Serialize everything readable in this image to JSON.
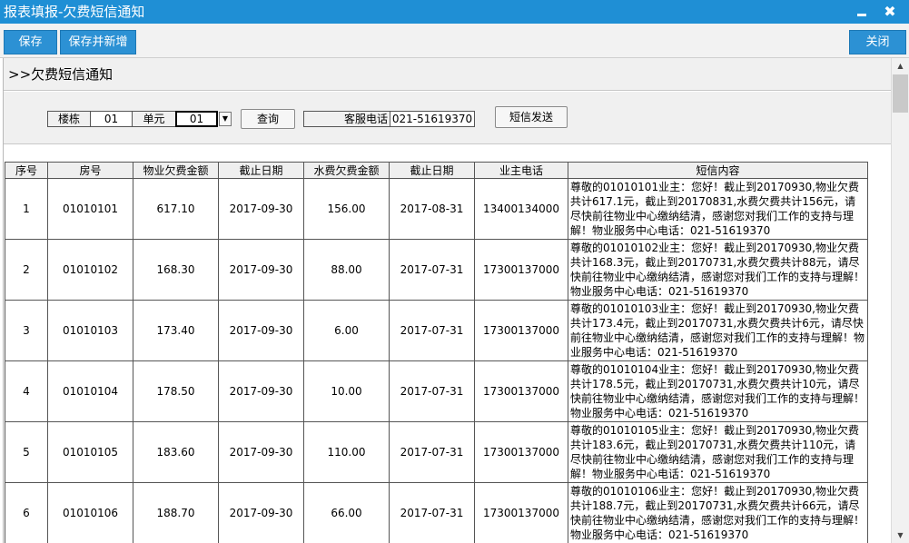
{
  "window": {
    "title": "报表填报-欠费短信通知",
    "minimize_icon": "minimize-icon",
    "close_icon": "close-icon",
    "close_glyph": "✖"
  },
  "toolbar": {
    "save_label": "保存",
    "save_new_label": "保存并新增",
    "close_label": "关闭"
  },
  "section": {
    "title": ">>欠费短信通知"
  },
  "filter": {
    "building_label": "楼栋",
    "building_value": "01",
    "unit_label": "单元",
    "unit_value": "01",
    "dropdown_glyph": "▼",
    "query_label": "查询",
    "service_phone_label": "客服电话",
    "service_phone_value": "021-51619370",
    "sms_send_label": "短信发送"
  },
  "table": {
    "headers": [
      "序号",
      "房号",
      "物业欠费金额",
      "截止日期",
      "水费欠费金额",
      "截止日期",
      "业主电话",
      "短信内容"
    ],
    "rows": [
      [
        "1",
        "01010101",
        "617.10",
        "2017-09-30",
        "156.00",
        "2017-08-31",
        "13400134000",
        "尊敬的01010101业主：您好！截止到20170930,物业欠费共计617.1元，截止到20170831,水费欠费共计156元，请尽快前往物业中心缴纳结清，感谢您对我们工作的支持与理解！物业服务中心电话：021-51619370"
      ],
      [
        "2",
        "01010102",
        "168.30",
        "2017-09-30",
        "88.00",
        "2017-07-31",
        "17300137000",
        "尊敬的01010102业主：您好！截止到20170930,物业欠费共计168.3元，截止到20170731,水费欠费共计88元，请尽快前往物业中心缴纳结清，感谢您对我们工作的支持与理解！物业服务中心电话：021-51619370"
      ],
      [
        "3",
        "01010103",
        "173.40",
        "2017-09-30",
        "6.00",
        "2017-07-31",
        "17300137000",
        "尊敬的01010103业主：您好！截止到20170930,物业欠费共计173.4元，截止到20170731,水费欠费共计6元，请尽快前往物业中心缴纳结清，感谢您对我们工作的支持与理解！物业服务中心电话：021-51619370"
      ],
      [
        "4",
        "01010104",
        "178.50",
        "2017-09-30",
        "10.00",
        "2017-07-31",
        "17300137000",
        "尊敬的01010104业主：您好！截止到20170930,物业欠费共计178.5元，截止到20170731,水费欠费共计10元，请尽快前往物业中心缴纳结清，感谢您对我们工作的支持与理解！物业服务中心电话：021-51619370"
      ],
      [
        "5",
        "01010105",
        "183.60",
        "2017-09-30",
        "110.00",
        "2017-07-31",
        "17300137000",
        "尊敬的01010105业主：您好！截止到20170930,物业欠费共计183.6元，截止到20170731,水费欠费共计110元，请尽快前往物业中心缴纳结清，感谢您对我们工作的支持与理解！物业服务中心电话：021-51619370"
      ],
      [
        "6",
        "01010106",
        "188.70",
        "2017-09-30",
        "66.00",
        "2017-07-31",
        "17300137000",
        "尊敬的01010106业主：您好！截止到20170930,物业欠费共计188.7元，截止到20170731,水费欠费共计66元，请尽快前往物业中心缴纳结清，感谢您对我们工作的支持与理解！物业服务中心电话：021-51619370"
      ]
    ]
  },
  "scrollbar": {
    "up_icon": "scroll-up-icon",
    "up_glyph": "▲",
    "down_icon": "scroll-down-icon",
    "down_glyph": "▼"
  }
}
